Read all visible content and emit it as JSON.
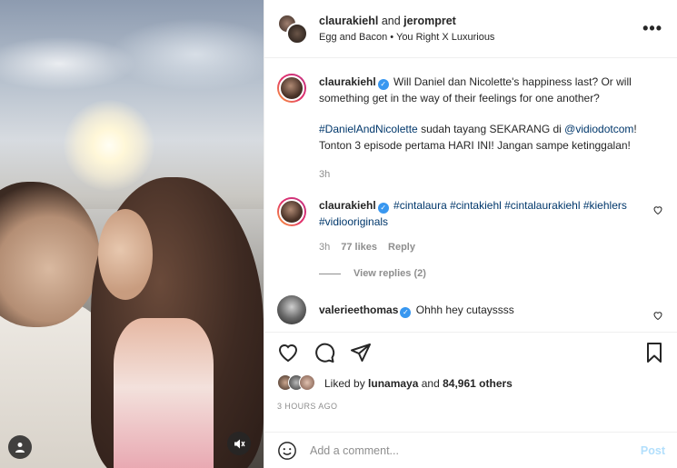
{
  "header": {
    "user1": "claurakiehl",
    "joiner": "and",
    "user2": "jerompret",
    "audio": "Egg and Bacon • You Right X Luxurious",
    "more_icon": "more-horizontal-icon"
  },
  "caption": {
    "username": "claurakiehl",
    "text1": "Will Daniel dan Nicolette's happiness last? Or will something get in the way of their feelings for one another?",
    "hashtag": "#DanielAndNicolette",
    "text2": " sudah tayang SEKARANG di ",
    "mention": "@vidiodotcom",
    "text3": "! Tonton 3 episode pertama HARI INI! Jangan sampe ketinggalan!",
    "time": "3h"
  },
  "comment1": {
    "username": "claurakiehl",
    "tags": "#cintalaura #cintakiehl #cintalaurakiehl #kiehlers #vidiooriginals",
    "time": "3h",
    "likes": "77 likes",
    "reply": "Reply",
    "view_replies": "View replies (2)"
  },
  "comment2": {
    "username": "valerieethomas",
    "text": "Ohhh hey cutayssss"
  },
  "liked_by": {
    "prefix": "Liked by",
    "user": "lunamaya",
    "and": "and",
    "others": "84,961 others"
  },
  "timestamp": "3 HOURS AGO",
  "add_comment": {
    "placeholder": "Add a comment...",
    "post": "Post"
  },
  "colors": {
    "link": "#00376b",
    "verified": "#3897f0",
    "post_disabled": "#b2dffc"
  }
}
